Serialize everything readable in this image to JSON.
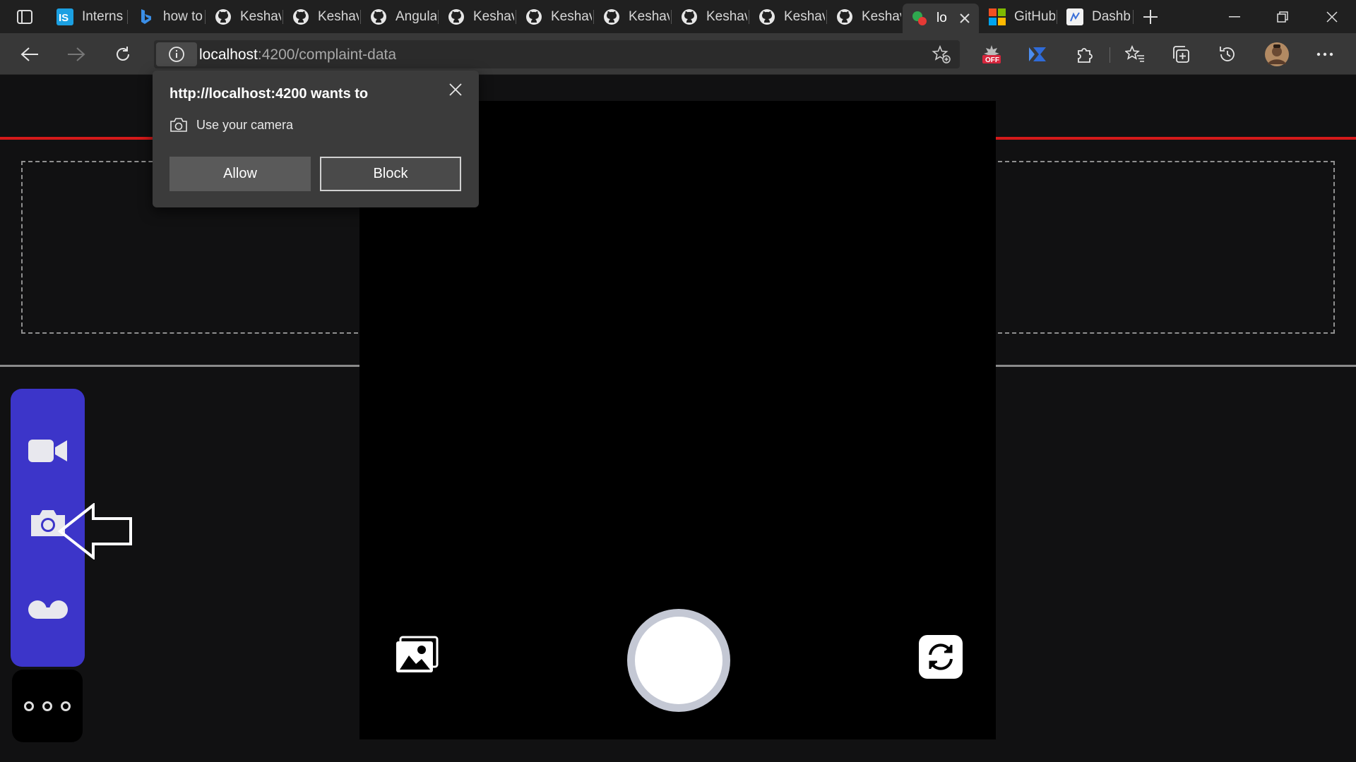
{
  "browser": {
    "tabs": [
      {
        "title": "Interns",
        "icon": "internshala-icon"
      },
      {
        "title": "how to",
        "icon": "bing-icon"
      },
      {
        "title": "Keshav",
        "icon": "github-icon"
      },
      {
        "title": "Keshav",
        "icon": "github-icon"
      },
      {
        "title": "Angula",
        "icon": "github-icon"
      },
      {
        "title": "Keshav",
        "icon": "github-icon"
      },
      {
        "title": "Keshav",
        "icon": "github-icon"
      },
      {
        "title": "Keshav",
        "icon": "github-icon"
      },
      {
        "title": "Keshav",
        "icon": "github-icon"
      },
      {
        "title": "Keshav",
        "icon": "github-icon"
      },
      {
        "title": "Keshav",
        "icon": "github-icon"
      },
      {
        "title": "lo",
        "icon": "app-icon",
        "active": true
      },
      {
        "title": "GitHub",
        "icon": "microsoft-icon"
      },
      {
        "title": "Dashb",
        "icon": "dashboard-icon"
      }
    ],
    "address": {
      "host": "localhost",
      "path": ":4200/complaint-data"
    },
    "extension_badge": "OFF"
  },
  "permission_prompt": {
    "title": "http://localhost:4200 wants to",
    "permission": "Use your camera",
    "allow_label": "Allow",
    "block_label": "Block"
  },
  "colors": {
    "accent_red": "#d51a1a",
    "mode_panel": "#3c35c9"
  }
}
